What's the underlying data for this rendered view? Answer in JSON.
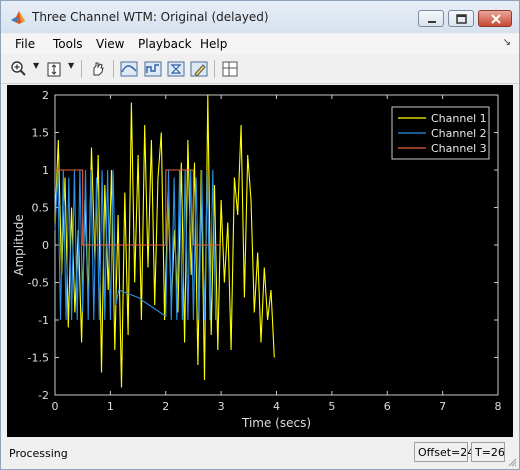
{
  "window": {
    "title": "Three Channel WTM: Original (delayed)",
    "icon": "matlab-icon",
    "controls": [
      "minimize-icon",
      "restore-icon",
      "close-icon"
    ]
  },
  "menu": {
    "items": [
      "File",
      "Tools",
      "View",
      "Playback",
      "Help"
    ],
    "arrow": "↘"
  },
  "toolbar": {
    "buttons": [
      "zoom-in-icon",
      "zoom-y-icon",
      "pan-icon",
      "autoscale-icon",
      "autoscale-x-icon",
      "autoscale-y-icon",
      "eraser-icon",
      "layout-icon"
    ]
  },
  "status": {
    "text": "Processing",
    "offset": "Offset=24",
    "time": "T=26"
  },
  "chart_data": {
    "type": "line",
    "xlabel": "Time (secs)",
    "ylabel": "Amplitude",
    "xlim": [
      0,
      8
    ],
    "ylim": [
      -2,
      2
    ],
    "xticks": [
      "0",
      "1",
      "2",
      "3",
      "4",
      "5",
      "6",
      "7",
      "8"
    ],
    "yticks": [
      "-2",
      "-1.5",
      "-1",
      "-0.5",
      "0",
      "0.5",
      "1",
      "1.5",
      "2"
    ],
    "grid": false,
    "legend_position": "top-right",
    "background": "#000000",
    "series": [
      {
        "name": "Channel 1",
        "color": "#ffff00",
        "x": [
          0,
          0.06,
          0.12,
          0.18,
          0.24,
          0.3,
          0.36,
          0.42,
          0.48,
          0.54,
          0.6,
          0.66,
          0.72,
          0.78,
          0.84,
          0.9,
          0.96,
          1.02,
          1.08,
          1.14,
          1.2,
          1.26,
          1.32,
          1.38,
          1.44,
          1.5,
          1.56,
          1.62,
          1.68,
          1.74,
          1.8,
          1.86,
          1.92,
          1.98,
          2.04,
          2.1,
          2.16,
          2.22,
          2.28,
          2.34,
          2.4,
          2.46,
          2.52,
          2.58,
          2.64,
          2.7,
          2.76,
          2.82,
          2.88,
          2.94,
          3.0,
          3.06,
          3.12,
          3.18,
          3.24,
          3.3,
          3.36,
          3.42,
          3.48,
          3.54,
          3.6,
          3.66,
          3.72,
          3.78,
          3.84,
          3.9,
          3.96
        ],
        "y": [
          0.3,
          1.4,
          -0.4,
          0.9,
          -1.1,
          0.5,
          -0.9,
          0.2,
          -1.3,
          0.6,
          -0.7,
          1.3,
          -0.2,
          1.2,
          -1.7,
          0.8,
          -0.6,
          1.0,
          -1.4,
          0.4,
          -1.9,
          0.7,
          -1.2,
          1.9,
          -0.5,
          1.2,
          -1.0,
          1.6,
          -0.3,
          1.4,
          -0.8,
          0.9,
          1.5,
          -1.0,
          0.7,
          -0.8,
          0.2,
          -0.9,
          1.1,
          -1.3,
          1.4,
          -0.4,
          1.1,
          -1.6,
          1.0,
          -1.8,
          2.0,
          -1.2,
          0.8,
          -1.4,
          0.6,
          -0.5,
          0.3,
          -1.4,
          0.9,
          0.4,
          1.6,
          -0.7,
          1.2,
          0.6,
          -0.9,
          -0.1,
          -1.3,
          -0.3,
          -1.0,
          -0.6,
          -1.5
        ]
      },
      {
        "name": "Channel 2",
        "color": "#2e8fe6",
        "x": [
          0,
          0.05,
          0.1,
          0.15,
          0.2,
          0.25,
          0.3,
          0.35,
          0.4,
          0.45,
          0.5,
          0.55,
          0.6,
          0.65,
          0.7,
          0.75,
          0.8,
          0.85,
          0.9,
          0.95,
          1.0,
          1.05,
          1.1,
          1.15,
          1.5,
          2.0,
          2.05,
          2.1,
          2.15,
          2.2,
          2.25,
          2.3,
          2.35,
          2.4,
          2.45,
          2.5,
          2.55,
          2.6,
          2.65,
          2.7,
          2.75,
          2.8,
          2.85,
          2.9
        ],
        "y": [
          0.2,
          1.0,
          -1.0,
          1.0,
          -1.0,
          0.9,
          -1.0,
          1.0,
          -1.0,
          1.0,
          -0.9,
          1.0,
          -1.0,
          1.0,
          -1.0,
          0.9,
          -1.0,
          1.0,
          -1.0,
          1.0,
          -1.0,
          1.0,
          -0.8,
          -0.6,
          -0.7,
          -0.95,
          1.0,
          -1.0,
          0.9,
          -1.0,
          1.0,
          -1.0,
          1.0,
          -1.0,
          1.0,
          -1.0,
          0.9,
          -1.0,
          1.0,
          -1.0,
          1.0,
          -1.0,
          1.0,
          -1.0
        ]
      },
      {
        "name": "Channel 3",
        "color": "#e8623d",
        "x": [
          0,
          0.5,
          0.5,
          2.0,
          2.0,
          2.5,
          2.5,
          3.0
        ],
        "y": [
          1,
          1,
          0,
          0,
          1,
          1,
          0,
          0
        ]
      }
    ]
  }
}
